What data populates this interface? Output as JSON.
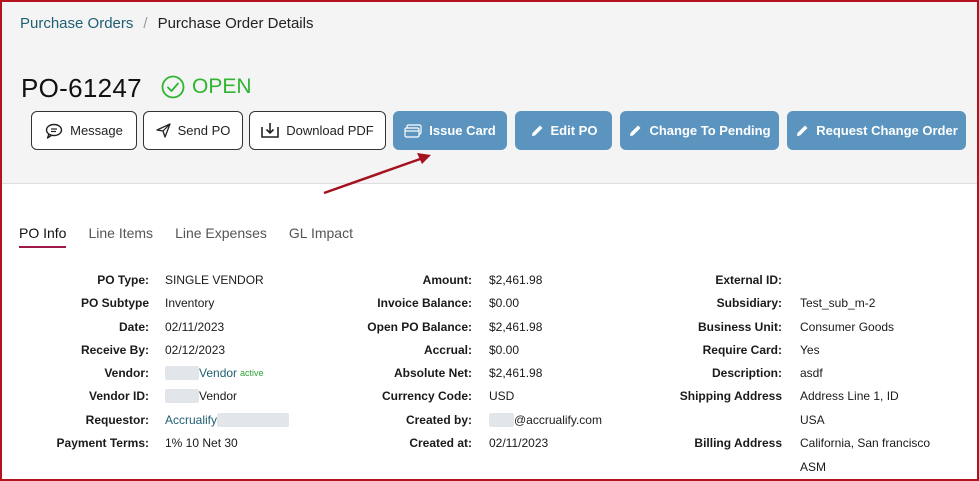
{
  "breadcrumb": {
    "parent": "Purchase Orders",
    "separator": "/",
    "current": "Purchase Order Details"
  },
  "po": {
    "number": "PO-61247",
    "status": "OPEN",
    "status_icon": "check-circle-icon"
  },
  "actions": {
    "message": "Message",
    "send_po": "Send PO",
    "download_pdf": "Download PDF",
    "issue_card": "Issue Card",
    "edit_po": "Edit PO",
    "change_to_pending": "Change To Pending",
    "request_change_order": "Request Change Order"
  },
  "tabs": [
    "PO Info",
    "Line Items",
    "Line Expenses",
    "GL Impact"
  ],
  "col1": {
    "po_type_label": "PO Type:",
    "po_type": "SINGLE VENDOR",
    "po_subtype_label": "PO Subtype",
    "po_subtype": "Inventory",
    "date_label": "Date:",
    "date": "02/11/2023",
    "receive_by_label": "Receive By:",
    "receive_by": "02/12/2023",
    "vendor_label": "Vendor:",
    "vendor": "Vendor",
    "vendor_badge": "active",
    "vendor_id_label": "Vendor ID:",
    "vendor_id": "Vendor",
    "requestor_label": "Requestor:",
    "requestor": "Accrualify",
    "payment_terms_label": "Payment Terms:",
    "payment_terms": "1% 10 Net 30"
  },
  "col2": {
    "amount_label": "Amount:",
    "amount": "$2,461.98",
    "invoice_balance_label": "Invoice Balance:",
    "invoice_balance": "$0.00",
    "open_po_balance_label": "Open PO Balance:",
    "open_po_balance": "$2,461.98",
    "accrual_label": "Accrual:",
    "accrual": "$0.00",
    "absolute_net_label": "Absolute Net:",
    "absolute_net": "$2,461.98",
    "currency_code_label": "Currency Code:",
    "currency_code": "USD",
    "created_by_label": "Created by:",
    "created_by": "@accrualify.com",
    "created_at_label": "Created at:",
    "created_at": "02/11/2023"
  },
  "col3": {
    "external_id_label": "External ID:",
    "external_id": "",
    "subsidiary_label": "Subsidiary:",
    "subsidiary": "Test_sub_m-2",
    "business_unit_label": "Business Unit:",
    "business_unit": "Consumer Goods",
    "require_card_label": "Require Card:",
    "require_card": "Yes",
    "description_label": "Description:",
    "description": "asdf",
    "shipping_address_label": "Shipping Address",
    "shipping_address_1": "Address Line 1, ID",
    "shipping_address_2": "USA",
    "billing_address_label": "Billing Address",
    "billing_address_1": "California, San francisco",
    "billing_address_2": "ASM"
  },
  "colors": {
    "accent": "#5b95bf",
    "status_green": "#2fb52f",
    "tab_underline": "#9c1b4a",
    "link": "#1f5f73",
    "frame": "#b3121e",
    "annotation_arrow": "#a5121f"
  }
}
